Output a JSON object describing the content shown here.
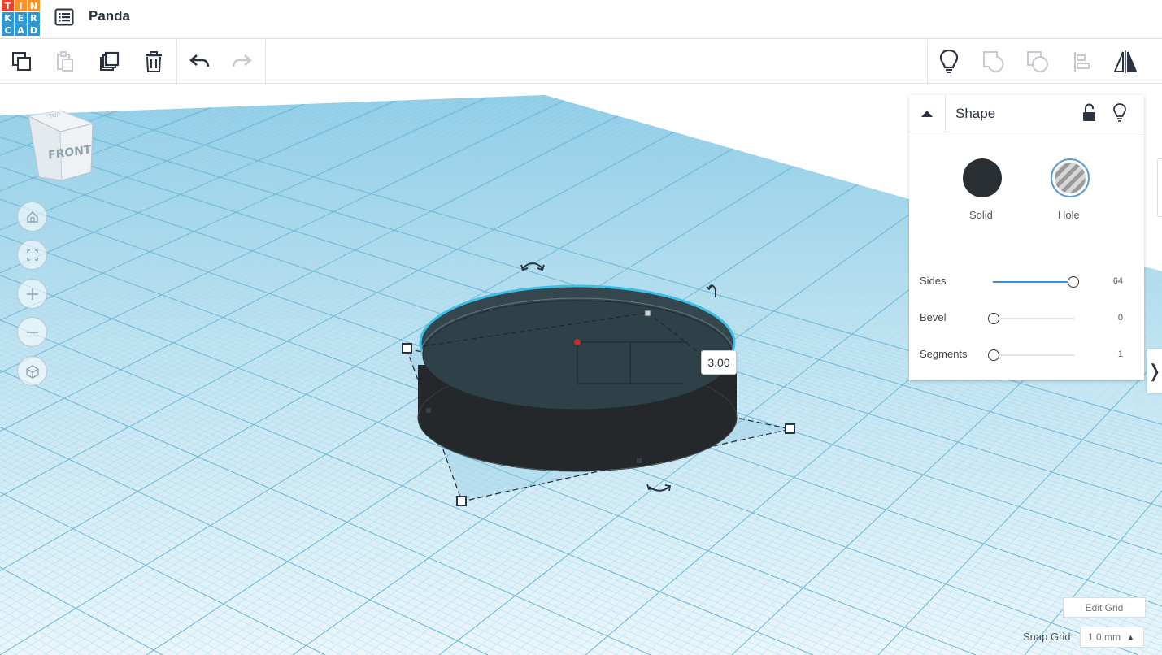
{
  "app": {
    "logo_letters": [
      "T",
      "I",
      "N",
      "K",
      "E",
      "R",
      "C",
      "A",
      "D"
    ],
    "logo_colors": [
      "#e8442b",
      "#f6932a",
      "#f6932a",
      "#2f97d3",
      "#2f97d3",
      "#2f97d3",
      "#2f97d3",
      "#2f97d3",
      "#2f97d3"
    ],
    "project_title": "Panda",
    "menu_icon": "list-icon"
  },
  "toolbar": {
    "left_icons": [
      "copy-icon",
      "paste-icon",
      "duplicate-icon",
      "delete-icon",
      "undo-icon",
      "redo-icon"
    ],
    "right_icons": [
      "lightbulb-icon",
      "group-icon",
      "ungroup-icon",
      "align-icon",
      "mirror-icon"
    ]
  },
  "viewcube": {
    "front_label": "FRONT",
    "top_label": "TOP"
  },
  "nav": {
    "icons": [
      "home-icon",
      "fit-view-icon",
      "zoom-in-icon",
      "zoom-out-icon",
      "perspective-icon"
    ]
  },
  "dimension_label": "3.00",
  "shape_panel": {
    "title": "Shape",
    "solid_label": "Solid",
    "hole_label": "Hole",
    "params": [
      {
        "label": "Sides",
        "value": "64",
        "fraction": 0.95
      },
      {
        "label": "Bevel",
        "value": "0",
        "fraction": 0.0
      },
      {
        "label": "Segments",
        "value": "1",
        "fraction": 0.0
      }
    ]
  },
  "grid_controls": {
    "edit_grid_label": "Edit Grid",
    "snap_grid_label": "Snap Grid",
    "snap_grid_value": "1.0 mm"
  },
  "colors": {
    "grid_blue": "#9fd4ea",
    "accent_blue": "#3a8bd1",
    "solid_color": "#2a2f33",
    "shape_top": "#34474e",
    "shape_side": "#24282b",
    "outline_cyan": "#3cc0e8"
  }
}
